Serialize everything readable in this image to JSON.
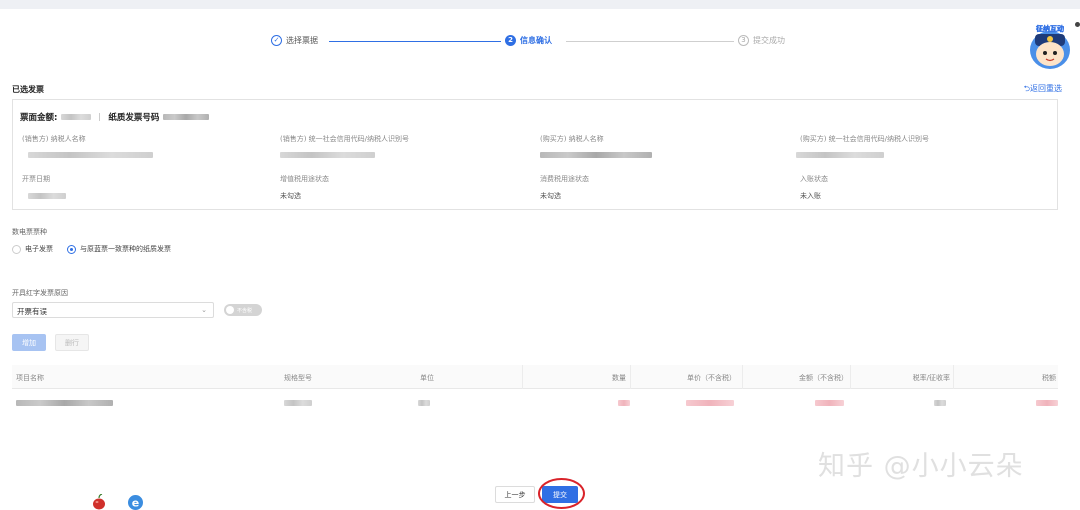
{
  "stepper": {
    "steps": [
      {
        "num": "✓",
        "label": "选择票据"
      },
      {
        "num": "2",
        "label": "信息确认"
      },
      {
        "num": "3",
        "label": "提交成功"
      }
    ]
  },
  "section": {
    "title": "已选发票",
    "back_link": "⮌返回重选"
  },
  "invoice": {
    "amount_label": "票面金额:",
    "paper_no_label": "纸质发票号码",
    "fields_row1": [
      "(销售方) 纳税人名称",
      "(销售方) 统一社会信用代码/纳税人识别号",
      "(购买方) 纳税人名称",
      "(购买方) 统一社会信用代码/纳税人识别号"
    ],
    "fields_row2": [
      "开票日期",
      "增值税用途状态",
      "消费税用途状态",
      "入账状态"
    ],
    "values_row2": [
      "未勾选",
      "未勾选",
      "未入账"
    ]
  },
  "form": {
    "type_label": "数电票票种",
    "radio_options": [
      "电子发票",
      "与原蓝票一致票种的纸质发票"
    ],
    "reason_label": "开具红字发票原因",
    "reason_value": "开票有误",
    "toggle_text": "不含税",
    "add_button": "增加",
    "delete_button": "删行"
  },
  "table": {
    "columns": [
      "项目名称",
      "规格型号",
      "单位",
      "数量",
      "单价（不含税）",
      "金额（不含税）",
      "税率/征收率",
      "税额"
    ]
  },
  "watermark": "知乎 @小小云朵",
  "footer": {
    "prev_button": "上一步",
    "submit_button": "提交"
  },
  "mascot": {
    "badge_text": "征纳互动"
  },
  "colors": {
    "primary": "#2f6fe4",
    "highlight_ring": "#d9232a"
  },
  "icons": [
    "check-circle-icon",
    "apple-icon",
    "ie-browser-icon",
    "chevron-down-icon"
  ]
}
